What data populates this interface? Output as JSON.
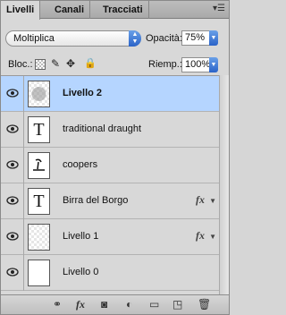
{
  "tabs": [
    {
      "label": "Livelli",
      "active": true
    },
    {
      "label": "Canali",
      "active": false
    },
    {
      "label": "Tracciati",
      "active": false
    }
  ],
  "blend_mode": {
    "value": "Moltiplica"
  },
  "opacity": {
    "label": "Opacità:",
    "value": "75%"
  },
  "lock": {
    "label": "Bloc.:",
    "icons": [
      "lock-transparency-icon",
      "lock-image-icon",
      "lock-position-icon",
      "lock-all-icon"
    ]
  },
  "fill": {
    "label": "Riemp.:",
    "value": "100%"
  },
  "layers": [
    {
      "name": "Livello 2",
      "thumb": "raster",
      "selected": true,
      "fx": false
    },
    {
      "name": "traditional draught",
      "thumb": "T",
      "selected": false,
      "fx": false
    },
    {
      "name": "coopers",
      "thumb": "raster",
      "selected": false,
      "fx": false
    },
    {
      "name": "Birra del Borgo",
      "thumb": "T",
      "selected": false,
      "fx": true,
      "fx_label": "fx"
    },
    {
      "name": "Livello 1",
      "thumb": "raster",
      "selected": false,
      "fx": true,
      "fx_label": "fx"
    },
    {
      "name": "Livello 0",
      "thumb": "raster",
      "selected": false,
      "fx": false
    }
  ],
  "bottom_bar": {
    "icons": [
      "link-layers-icon",
      "layer-style-icon",
      "layer-mask-icon",
      "adjustment-layer-icon",
      "new-group-icon",
      "new-layer-icon",
      "delete-layer-icon"
    ],
    "fx_label": "fx"
  },
  "colors": {
    "selection": "#b5d5ff",
    "panel": "#d8d8d8",
    "accent": "#2a63c8"
  }
}
